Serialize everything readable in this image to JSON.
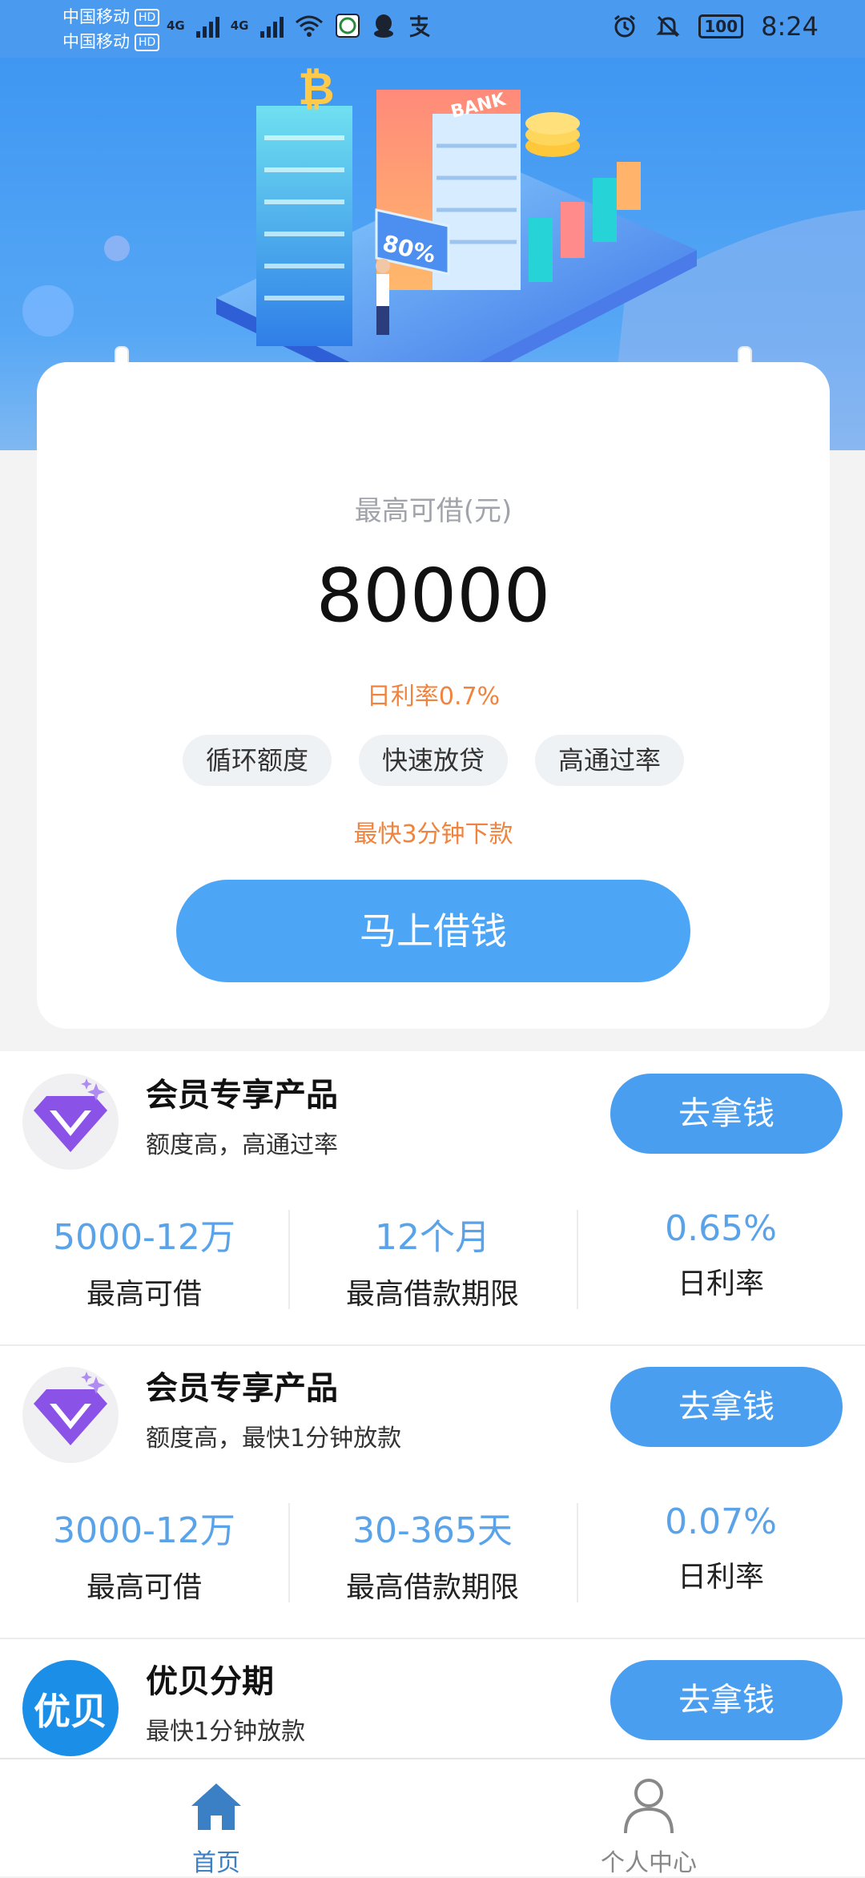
{
  "status_bar": {
    "carrier_1": "中国移动",
    "carrier_2": "中国移动",
    "hd": "HD",
    "net_1": "4G",
    "net_2": "4G",
    "battery": "100",
    "time": "8:24"
  },
  "banner": {
    "bank_text": "BANK",
    "percent_text": "80%"
  },
  "loan_card": {
    "label": "最高可借(元)",
    "amount": "80000",
    "rate": "日利率0.7%",
    "tags": [
      "循环额度",
      "快速放贷",
      "高通过率"
    ],
    "fast_text": "最快3分钟下款",
    "button_label": "马上借钱"
  },
  "products": [
    {
      "name": "会员专享产品",
      "desc": "额度高，高通过率",
      "button": "去拿钱",
      "stats": [
        {
          "value": "5000-12万",
          "label": "最高可借"
        },
        {
          "value": "12个月",
          "label": "最高借款期限"
        },
        {
          "value": "0.65%",
          "label": "日利率"
        }
      ]
    },
    {
      "name": "会员专享产品",
      "desc": "额度高，最快1分钟放款",
      "button": "去拿钱",
      "stats": [
        {
          "value": "3000-12万",
          "label": "最高可借"
        },
        {
          "value": "30-365天",
          "label": "最高借款期限"
        },
        {
          "value": "0.07%",
          "label": "日利率"
        }
      ]
    },
    {
      "name": "优贝分期",
      "desc": "最快1分钟放款",
      "button": "去拿钱",
      "logo_text": "优贝"
    }
  ],
  "bottom_nav": {
    "home": "首页",
    "profile": "个人中心",
    "active_color": "#3b7fc4",
    "inactive_color": "#888888"
  },
  "colors": {
    "accent": "#4a9ef0",
    "orange": "#f0833e",
    "stat_blue": "#5aa3e8"
  }
}
